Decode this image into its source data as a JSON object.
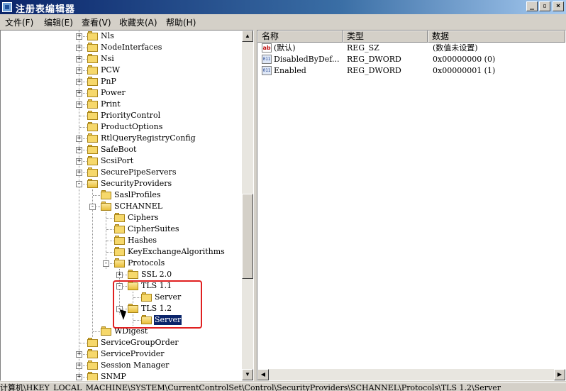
{
  "window": {
    "title": "注册表编辑器",
    "min_label": "_",
    "max_label": "▫",
    "close_label": "×"
  },
  "menu": [
    "文件(F)",
    "编辑(E)",
    "查看(V)",
    "收藏夹(A)",
    "帮助(H)"
  ],
  "tree": [
    {
      "label": "Nls",
      "level": 0,
      "expander": "+"
    },
    {
      "label": "NodeInterfaces",
      "level": 0,
      "expander": "+"
    },
    {
      "label": "Nsi",
      "level": 0,
      "expander": "+"
    },
    {
      "label": "PCW",
      "level": 0,
      "expander": "+"
    },
    {
      "label": "PnP",
      "level": 0,
      "expander": "+"
    },
    {
      "label": "Power",
      "level": 0,
      "expander": "+"
    },
    {
      "label": "Print",
      "level": 0,
      "expander": "+"
    },
    {
      "label": "PriorityControl",
      "level": 0,
      "expander": ""
    },
    {
      "label": "ProductOptions",
      "level": 0,
      "expander": ""
    },
    {
      "label": "RtlQueryRegistryConfig",
      "level": 0,
      "expander": "+"
    },
    {
      "label": "SafeBoot",
      "level": 0,
      "expander": "+"
    },
    {
      "label": "ScsiPort",
      "level": 0,
      "expander": "+"
    },
    {
      "label": "SecurePipeServers",
      "level": 0,
      "expander": "+"
    },
    {
      "label": "SecurityProviders",
      "level": 0,
      "expander": "-"
    },
    {
      "label": "SaslProfiles",
      "level": 1,
      "expander": ""
    },
    {
      "label": "SCHANNEL",
      "level": 1,
      "expander": "-"
    },
    {
      "label": "Ciphers",
      "level": 2,
      "expander": ""
    },
    {
      "label": "CipherSuites",
      "level": 2,
      "expander": ""
    },
    {
      "label": "Hashes",
      "level": 2,
      "expander": ""
    },
    {
      "label": "KeyExchangeAlgorithms",
      "level": 2,
      "expander": ""
    },
    {
      "label": "Protocols",
      "level": 2,
      "expander": "-"
    },
    {
      "label": "SSL 2.0",
      "level": 3,
      "expander": "+"
    },
    {
      "label": "TLS 1.1",
      "level": 3,
      "expander": "-"
    },
    {
      "label": "Server",
      "level": 4,
      "expander": ""
    },
    {
      "label": "TLS 1.2",
      "level": 3,
      "expander": "-"
    },
    {
      "label": "Server",
      "level": 4,
      "expander": "",
      "selected": true
    },
    {
      "label": "WDigest",
      "level": 1,
      "expander": ""
    },
    {
      "label": "ServiceGroupOrder",
      "level": 0,
      "expander": ""
    },
    {
      "label": "ServiceProvider",
      "level": 0,
      "expander": "+"
    },
    {
      "label": "Session Manager",
      "level": 0,
      "expander": "+"
    },
    {
      "label": "SNMP",
      "level": 0,
      "expander": "+"
    }
  ],
  "list": {
    "columns": [
      "名称",
      "类型",
      "数据"
    ],
    "rows": [
      {
        "icon": "string-value-icon",
        "kind": "sz",
        "name": "(默认)",
        "type": "REG_SZ",
        "data": "(数值未设置)"
      },
      {
        "icon": "dword-value-icon",
        "kind": "dword",
        "name": "DisabledByDef...",
        "type": "REG_DWORD",
        "data": "0x00000000 (0)"
      },
      {
        "icon": "dword-value-icon",
        "kind": "dword",
        "name": "Enabled",
        "type": "REG_DWORD",
        "data": "0x00000001 (1)"
      }
    ]
  },
  "status": {
    "path": "计算机\\HKEY_LOCAL_MACHINE\\SYSTEM\\CurrentControlSet\\Control\\SecurityProviders\\SCHANNEL\\Protocols\\TLS 1.2\\Server"
  },
  "colors": {
    "selection": "#0a246a",
    "annotation_box": "#e02020",
    "folder": "#f6d86b"
  }
}
